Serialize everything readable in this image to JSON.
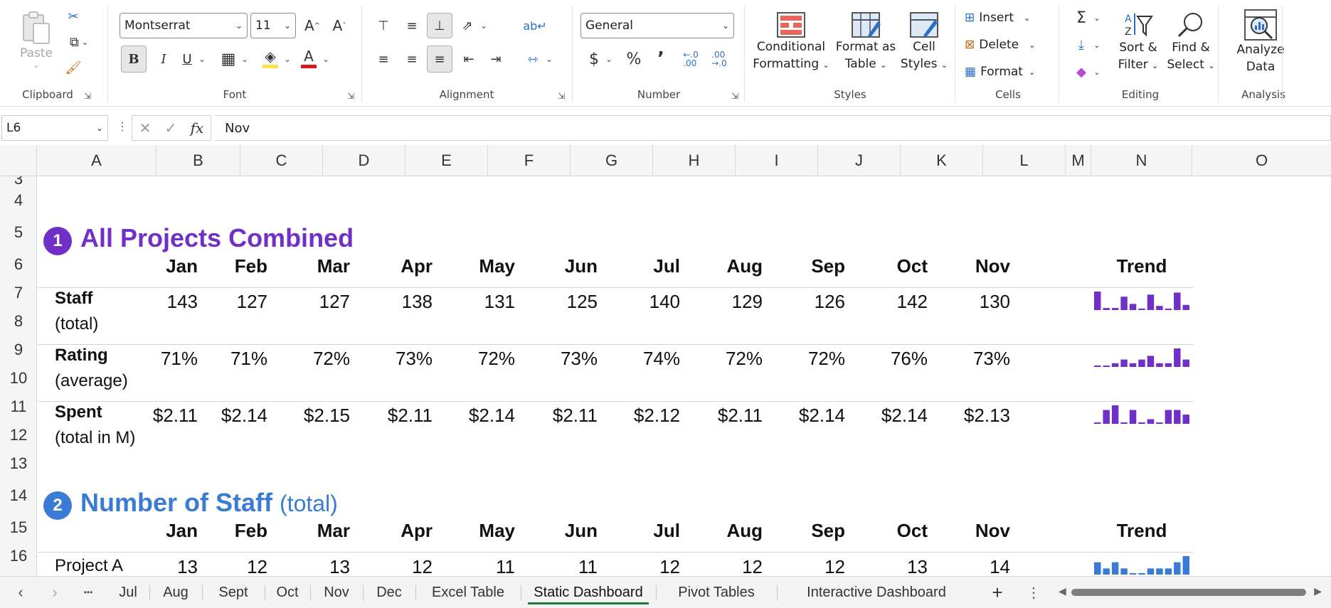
{
  "ribbon": {
    "clipboard": {
      "label": "Clipboard",
      "paste": "Paste"
    },
    "font": {
      "label": "Font",
      "family": "Montserrat",
      "size": "11",
      "bold": "B",
      "italic": "I",
      "underline": "U"
    },
    "alignment": {
      "label": "Alignment"
    },
    "number": {
      "label": "Number",
      "format": "General",
      "dollar": "$",
      "percent": "%",
      "comma": "’",
      "inc_dec": "←.0\n.00",
      "dec_dec": ".00\n→.0"
    },
    "styles": {
      "label": "Styles",
      "conditional_line1": "Conditional",
      "conditional_line2": "Formatting",
      "format_table_line1": "Format as",
      "format_table_line2": "Table",
      "cell_styles_line1": "Cell",
      "cell_styles_line2": "Styles"
    },
    "cells": {
      "label": "Cells",
      "insert": "Insert",
      "delete": "Delete",
      "format": "Format"
    },
    "editing": {
      "label": "Editing",
      "sort_line1": "Sort &",
      "sort_line2": "Filter",
      "find_line1": "Find &",
      "find_line2": "Select"
    },
    "analysis": {
      "label": "Analysis",
      "analyze_line1": "Analyze",
      "analyze_line2": "Data"
    }
  },
  "formula_bar": {
    "name_box": "L6",
    "value": "Nov",
    "fx": "fx"
  },
  "columns": [
    "A",
    "B",
    "C",
    "D",
    "E",
    "F",
    "G",
    "H",
    "I",
    "J",
    "K",
    "L",
    "M",
    "N",
    "O"
  ],
  "rows": [
    "3",
    "4",
    "5",
    "6",
    "7",
    "8",
    "9",
    "10",
    "11",
    "12",
    "13",
    "14",
    "15",
    "16"
  ],
  "section1": {
    "badge": "1",
    "title": "All Projects Combined",
    "color": "#7030c8",
    "months": [
      "Jan",
      "Feb",
      "Mar",
      "Apr",
      "May",
      "Jun",
      "Jul",
      "Aug",
      "Sep",
      "Oct",
      "Nov"
    ],
    "trend_label": "Trend",
    "rows": [
      {
        "label": "Staff",
        "sub": "(total)",
        "values": [
          "143",
          "127",
          "127",
          "138",
          "131",
          "125",
          "140",
          "129",
          "126",
          "142",
          "130"
        ],
        "raw": [
          143,
          127,
          127,
          138,
          131,
          125,
          140,
          129,
          126,
          142,
          130
        ]
      },
      {
        "label": "Rating",
        "sub": "(average)",
        "values": [
          "71%",
          "71%",
          "72%",
          "73%",
          "72%",
          "73%",
          "74%",
          "72%",
          "72%",
          "76%",
          "73%"
        ],
        "raw": [
          71,
          71,
          72,
          73,
          72,
          73,
          74,
          72,
          72,
          76,
          73
        ]
      },
      {
        "label": "Spent",
        "sub": "(total in M)",
        "values": [
          "$2.11",
          "$2.14",
          "$2.15",
          "$2.11",
          "$2.14",
          "$2.11",
          "$2.12",
          "$2.11",
          "$2.14",
          "$2.14",
          "$2.13"
        ],
        "raw": [
          2.11,
          2.14,
          2.15,
          2.11,
          2.14,
          2.11,
          2.12,
          2.11,
          2.14,
          2.14,
          2.13
        ]
      }
    ]
  },
  "section2": {
    "badge": "2",
    "title": "Number of Staff",
    "title_suffix": "(total)",
    "color": "#3a7bd5",
    "months": [
      "Jan",
      "Feb",
      "Mar",
      "Apr",
      "May",
      "Jun",
      "Jul",
      "Aug",
      "Sep",
      "Oct",
      "Nov"
    ],
    "trend_label": "Trend",
    "rows": [
      {
        "label": "Project A",
        "values": [
          "13",
          "12",
          "13",
          "12",
          "11",
          "11",
          "12",
          "12",
          "12",
          "13",
          "14"
        ],
        "raw": [
          13,
          12,
          13,
          12,
          11,
          11,
          12,
          12,
          12,
          13,
          14
        ]
      }
    ]
  },
  "sheet_tabs": {
    "tabs": [
      "Jul",
      "Aug",
      "Sept",
      "Oct",
      "Nov",
      "Dec",
      "Excel Table",
      "Static Dashboard",
      "Pivot Tables",
      "Interactive Dashboard"
    ],
    "active": "Static Dashboard",
    "more": "•••",
    "add": "+"
  }
}
